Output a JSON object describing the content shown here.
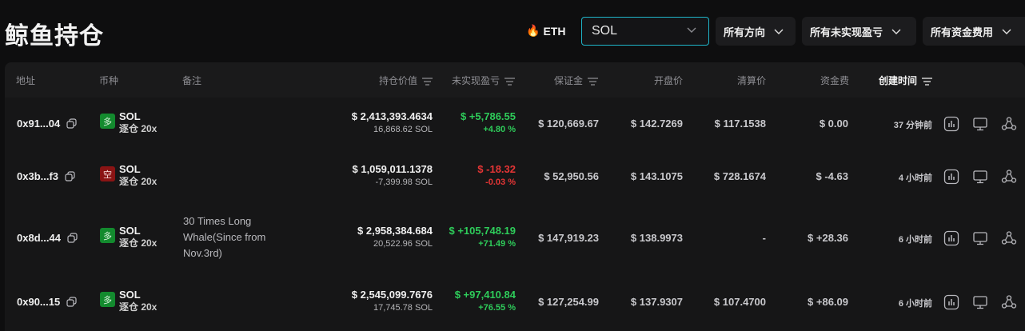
{
  "page_title": "鲸鱼持仓",
  "coin_tabs": {
    "eth_label": "ETH"
  },
  "coin_select": {
    "value": "SOL"
  },
  "filters": [
    {
      "label": "所有方向"
    },
    {
      "label": "所有未实现盈亏"
    },
    {
      "label": "所有资金费用"
    }
  ],
  "columns": {
    "address": "地址",
    "coin": "币种",
    "note": "备注",
    "position_value": "持仓价值",
    "unrealized_pnl": "未实现盈亏",
    "margin": "保证金",
    "entry_price": "开盘价",
    "liq_price": "清算价",
    "funding": "资金费",
    "created": "创建时间"
  },
  "rows": [
    {
      "address": "0x91...04",
      "side": "多",
      "side_type": "long",
      "coin": "SOL",
      "leverage": "逐仓 20x",
      "note": "",
      "value": "$ 2,413,393.4634",
      "size": "16,868.62 SOL",
      "pnl": "$ +5,786.55",
      "pnl_pct": "+4.80 %",
      "pnl_sign": "pos",
      "margin": "$ 120,669.67",
      "entry": "$ 142.7269",
      "liq": "$ 117.1538",
      "funding": "$ 0.00",
      "funding_sign": "neutral",
      "created": "37 分钟前"
    },
    {
      "address": "0x3b...f3",
      "side": "空",
      "side_type": "short",
      "coin": "SOL",
      "leverage": "逐仓 20x",
      "note": "",
      "value": "$ 1,059,011.1378",
      "size": "-7,399.98 SOL",
      "pnl": "$ -18.32",
      "pnl_pct": "-0.03 %",
      "pnl_sign": "neg",
      "margin": "$ 52,950.56",
      "entry": "$ 143.1075",
      "liq": "$ 728.1674",
      "funding": "$ -4.63",
      "funding_sign": "neg",
      "created": "4 小时前"
    },
    {
      "address": "0x8d...44",
      "side": "多",
      "side_type": "long",
      "coin": "SOL",
      "leverage": "逐仓 20x",
      "note": "30 Times Long Whale(Since from Nov.3rd)",
      "value": "$ 2,958,384.684",
      "size": "20,522.96 SOL",
      "pnl": "$ +105,748.19",
      "pnl_pct": "+71.49 %",
      "pnl_sign": "pos",
      "margin": "$ 147,919.23",
      "entry": "$ 138.9973",
      "liq": "-",
      "funding": "$ +28.36",
      "funding_sign": "pos",
      "created": "6 小时前"
    },
    {
      "address": "0x90...15",
      "side": "多",
      "side_type": "long",
      "coin": "SOL",
      "leverage": "逐仓 20x",
      "note": "",
      "value": "$ 2,545,099.7676",
      "size": "17,745.78 SOL",
      "pnl": "$ +97,410.84",
      "pnl_pct": "+76.55 %",
      "pnl_sign": "pos",
      "margin": "$ 127,254.99",
      "entry": "$ 137.9307",
      "liq": "$ 107.4700",
      "funding": "$ +86.09",
      "funding_sign": "pos",
      "created": "6 小时前"
    }
  ]
}
